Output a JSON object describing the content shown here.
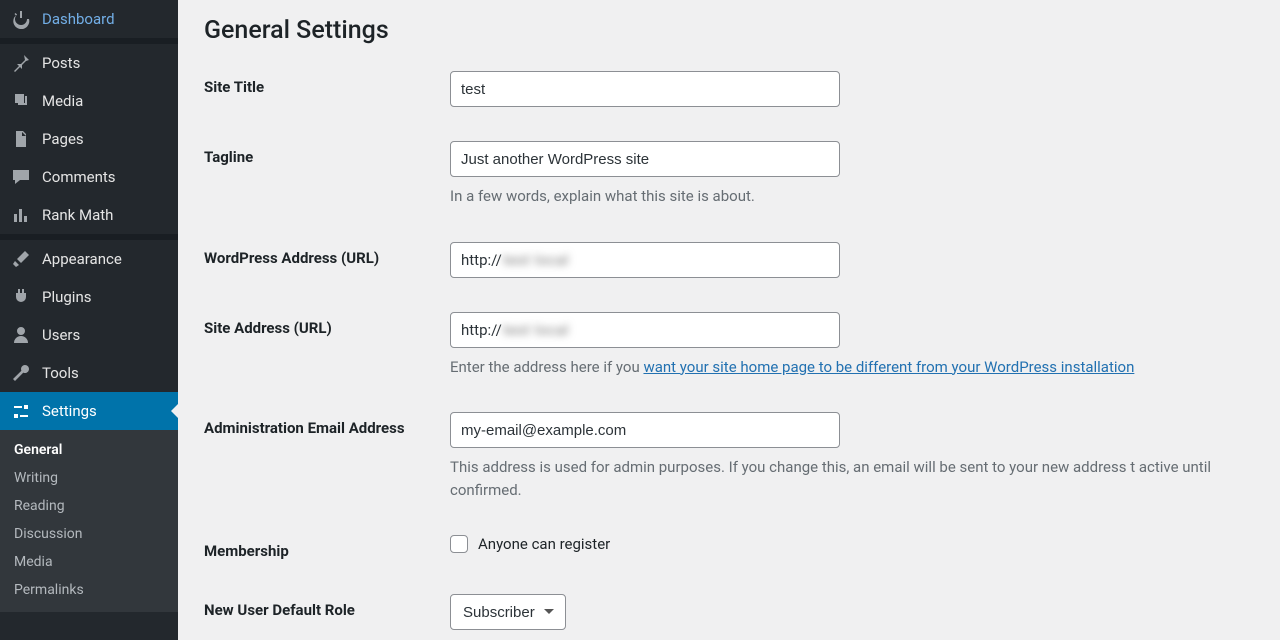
{
  "sidebar": {
    "items": [
      {
        "label": "Dashboard",
        "icon": "dashboard"
      },
      {
        "label": "Posts",
        "icon": "pin"
      },
      {
        "label": "Media",
        "icon": "media"
      },
      {
        "label": "Pages",
        "icon": "pages"
      },
      {
        "label": "Comments",
        "icon": "comment"
      },
      {
        "label": "Rank Math",
        "icon": "chart"
      },
      {
        "label": "Appearance",
        "icon": "brush"
      },
      {
        "label": "Plugins",
        "icon": "plug"
      },
      {
        "label": "Users",
        "icon": "user"
      },
      {
        "label": "Tools",
        "icon": "wrench"
      },
      {
        "label": "Settings",
        "icon": "sliders",
        "current": true
      }
    ],
    "submenu": [
      {
        "label": "General",
        "active": true
      },
      {
        "label": "Writing"
      },
      {
        "label": "Reading"
      },
      {
        "label": "Discussion"
      },
      {
        "label": "Media"
      },
      {
        "label": "Permalinks"
      }
    ]
  },
  "page": {
    "title": "General Settings",
    "fields": {
      "site_title": {
        "label": "Site Title",
        "value": "test"
      },
      "tagline": {
        "label": "Tagline",
        "value": "Just another WordPress site",
        "desc": "In a few words, explain what this site is about."
      },
      "wp_url": {
        "label": "WordPress Address (URL)",
        "prefix": "http://",
        "blurred": "test  local"
      },
      "site_url": {
        "label": "Site Address (URL)",
        "prefix": "http://",
        "blurred": "test  local",
        "desc_pre": "Enter the address here if you ",
        "desc_link": "want your site home page to be different from your WordPress installation"
      },
      "admin_email": {
        "label": "Administration Email Address",
        "value": "my-email@example.com",
        "desc": "This address is used for admin purposes. If you change this, an email will be sent to your new address t active until confirmed."
      },
      "membership": {
        "label": "Membership",
        "checkbox_label": "Anyone can register",
        "checked": false
      },
      "default_role": {
        "label": "New User Default Role",
        "value": "Subscriber"
      }
    }
  }
}
